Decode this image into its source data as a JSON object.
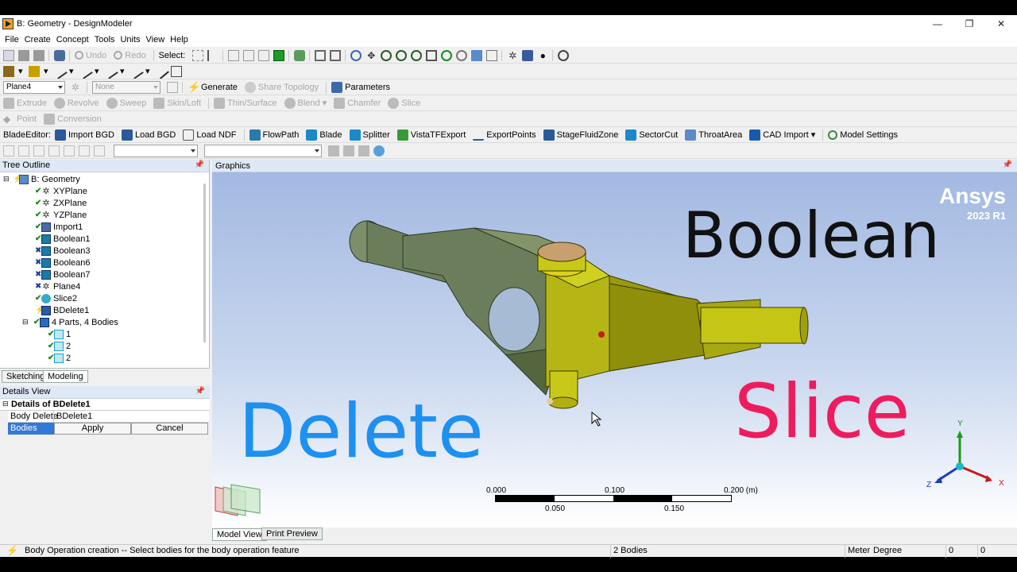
{
  "window": {
    "title": "B: Geometry - DesignModeler"
  },
  "menu": [
    "File",
    "Create",
    "Concept",
    "Tools",
    "Units",
    "View",
    "Help"
  ],
  "toolbar1": {
    "undo": "Undo",
    "redo": "Redo",
    "select": "Select:"
  },
  "toolbar3": {
    "plane_combo": "Plane4",
    "none_combo": "None",
    "generate": "Generate",
    "share_topology": "Share Topology",
    "parameters": "Parameters"
  },
  "toolbar4": [
    "Extrude",
    "Revolve",
    "Sweep",
    "Skin/Loft",
    "Thin/Surface",
    "Blend",
    "Chamfer",
    "Slice"
  ],
  "toolbar5": [
    "Point",
    "Conversion"
  ],
  "toolbar6": {
    "label": "BladeEditor:",
    "items": [
      "Import BGD",
      "Load BGD",
      "Load NDF",
      "FlowPath",
      "Blade",
      "Splitter",
      "VistaTFExport",
      "ExportPoints",
      "StageFluidZone",
      "SectorCut",
      "ThroatArea",
      "CAD Import",
      "Model Settings"
    ]
  },
  "tree": {
    "header": "Tree Outline",
    "root": "B: Geometry",
    "items": [
      {
        "label": "XYPlane",
        "status": "check",
        "icon": "plane-icon"
      },
      {
        "label": "ZXPlane",
        "status": "check",
        "icon": "plane-icon"
      },
      {
        "label": "YZPlane",
        "status": "check",
        "icon": "plane-icon"
      },
      {
        "label": "Import1",
        "status": "check",
        "icon": "import-icon"
      },
      {
        "label": "Boolean1",
        "status": "check",
        "icon": "boolean-icon"
      },
      {
        "label": "Boolean3",
        "status": "x",
        "icon": "boolean-icon"
      },
      {
        "label": "Boolean6",
        "status": "x",
        "icon": "boolean-icon"
      },
      {
        "label": "Boolean7",
        "status": "x",
        "icon": "boolean-icon"
      },
      {
        "label": "Plane4",
        "status": "x",
        "icon": "plane-icon"
      },
      {
        "label": "Slice2",
        "status": "check",
        "icon": "slice-icon"
      },
      {
        "label": "BDelete1",
        "status": "lightning",
        "icon": "bdelete-icon"
      },
      {
        "label": "4 Parts, 4 Bodies",
        "status": "check",
        "icon": "parts-icon"
      }
    ],
    "bodies": [
      "1",
      "2",
      "2"
    ],
    "tabs": [
      "Sketching",
      "Modeling"
    ]
  },
  "details": {
    "header": "Details View",
    "title": "Details of BDelete1",
    "row_label": "Body Delete",
    "row_value": "BDelete1",
    "field": "Bodies",
    "apply": "Apply",
    "cancel": "Cancel"
  },
  "graphics": {
    "header": "Graphics",
    "brand": "Ansys",
    "version": "2023 R1",
    "overlay": {
      "boolean": "Boolean",
      "delete": "Delete",
      "slice": "Slice"
    },
    "overlay_colors": {
      "boolean": "#111111",
      "delete": "#1e90f0",
      "slice": "#ee1c5e"
    },
    "scale": {
      "labels_top": [
        "0.000",
        "0.100",
        "0.200 (m)"
      ],
      "labels_bottom": [
        "0.050",
        "0.150"
      ]
    },
    "axis_labels": {
      "y": "Y",
      "z": "Z",
      "x": "X"
    },
    "tabs": [
      "Model View",
      "Print Preview"
    ]
  },
  "status": {
    "message": "Body Operation creation -- Select bodies for the body operation feature",
    "bodies": "2 Bodies",
    "units": "Meter",
    "angle": "Degree",
    "v1": "0",
    "v2": "0"
  }
}
